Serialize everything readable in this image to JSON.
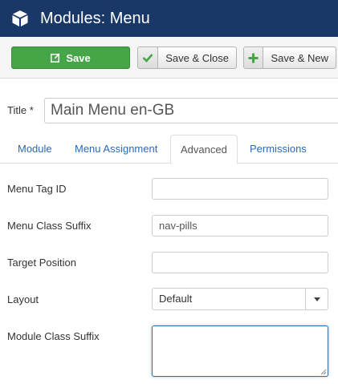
{
  "header": {
    "title": "Modules: Menu",
    "icon": "cube-icon",
    "background": "#1a3867"
  },
  "toolbar": {
    "save_label": "Save",
    "save_close_label": "Save & Close",
    "save_new_label": "Save & New",
    "save_color": "#46a546"
  },
  "title_field": {
    "label": "Title *",
    "value": "Main Menu en-GB"
  },
  "tabs": [
    {
      "label": "Module",
      "active": false
    },
    {
      "label": "Menu Assignment",
      "active": false
    },
    {
      "label": "Advanced",
      "active": true
    },
    {
      "label": "Permissions",
      "active": false
    }
  ],
  "fields": {
    "menu_tag_id": {
      "label": "Menu Tag ID",
      "value": ""
    },
    "menu_class_suffix": {
      "label": "Menu Class Suffix",
      "value": "nav-pills"
    },
    "target_position": {
      "label": "Target Position",
      "value": ""
    },
    "layout": {
      "label": "Layout",
      "value": "Default"
    },
    "module_class_suffix": {
      "label": "Module Class Suffix",
      "value": ""
    }
  },
  "colors": {
    "link": "#2a69b8",
    "focus_border": "#3071a9"
  }
}
